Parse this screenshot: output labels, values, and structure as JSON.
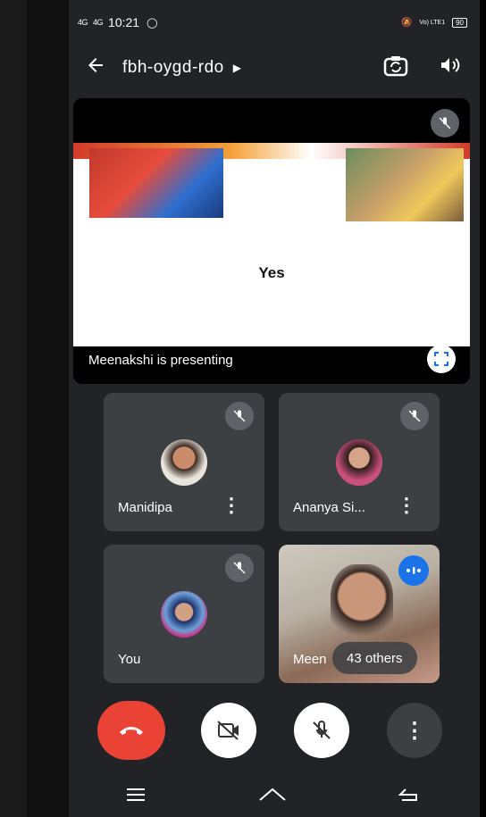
{
  "status_bar": {
    "signal1": "4G",
    "signal2": "4G",
    "time": "10:21",
    "volte": "Vo) LTE1",
    "battery": "90"
  },
  "header": {
    "meeting_code": "fbh-oygd-rdo"
  },
  "presentation": {
    "slide_text": "Yes",
    "presenter_label": "Meenakshi is presenting"
  },
  "participants": [
    {
      "name": "Manidipa"
    },
    {
      "name": "Ananya Si..."
    },
    {
      "name": "You"
    },
    {
      "name": "Meen"
    }
  ],
  "others": {
    "label": "43 others"
  },
  "colors": {
    "end_call": "#ea4335",
    "speaker_badge": "#1a73e8",
    "tile_bg": "#3c4043"
  }
}
